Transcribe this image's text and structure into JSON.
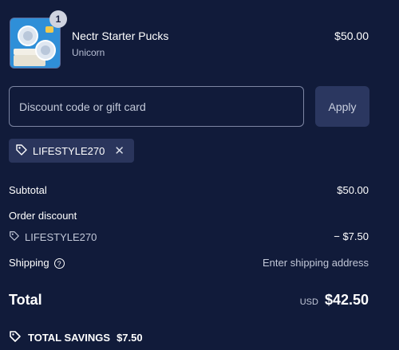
{
  "product": {
    "quantity": "1",
    "name": "Nectr Starter Pucks",
    "variant": "Unicorn",
    "price": "$50.00"
  },
  "discount": {
    "placeholder": "Discount code or gift card",
    "apply_label": "Apply",
    "applied_code": "LIFESTYLE270"
  },
  "summary": {
    "subtotal_label": "Subtotal",
    "subtotal_value": "$50.00",
    "order_discount_label": "Order discount",
    "order_discount_code": "LIFESTYLE270",
    "order_discount_value": "− $7.50",
    "shipping_label": "Shipping",
    "shipping_value": "Enter shipping address",
    "total_label": "Total",
    "currency": "USD",
    "total_value": "$42.50",
    "savings_label": "TOTAL SAVINGS",
    "savings_value": "$7.50"
  },
  "colors": {
    "background": "#111b3a",
    "chip": "#2a355c",
    "apply_button": "#2b3760"
  },
  "icons": {
    "tag": "tag-icon",
    "close": "close-icon",
    "help": "help-circle-icon"
  }
}
